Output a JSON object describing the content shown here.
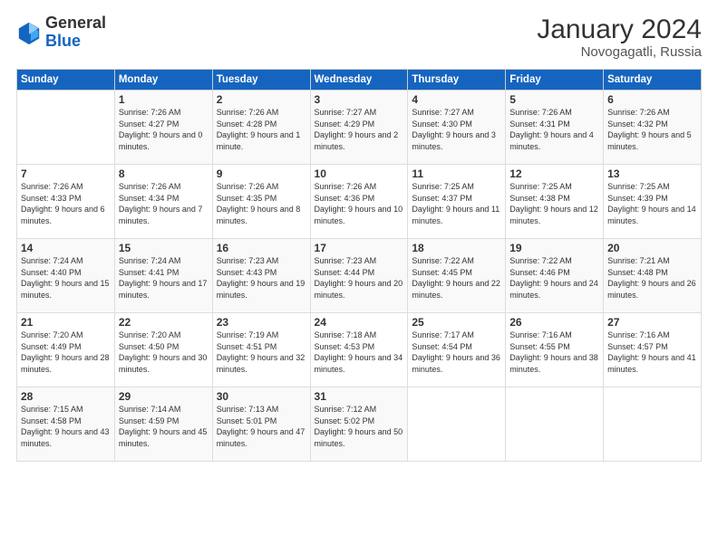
{
  "header": {
    "logo_general": "General",
    "logo_blue": "Blue",
    "month_year": "January 2024",
    "location": "Novogagatli, Russia"
  },
  "columns": [
    "Sunday",
    "Monday",
    "Tuesday",
    "Wednesday",
    "Thursday",
    "Friday",
    "Saturday"
  ],
  "weeks": [
    [
      {
        "day": "",
        "sunrise": "",
        "sunset": "",
        "daylight": ""
      },
      {
        "day": "1",
        "sunrise": "Sunrise: 7:26 AM",
        "sunset": "Sunset: 4:27 PM",
        "daylight": "Daylight: 9 hours and 0 minutes."
      },
      {
        "day": "2",
        "sunrise": "Sunrise: 7:26 AM",
        "sunset": "Sunset: 4:28 PM",
        "daylight": "Daylight: 9 hours and 1 minute."
      },
      {
        "day": "3",
        "sunrise": "Sunrise: 7:27 AM",
        "sunset": "Sunset: 4:29 PM",
        "daylight": "Daylight: 9 hours and 2 minutes."
      },
      {
        "day": "4",
        "sunrise": "Sunrise: 7:27 AM",
        "sunset": "Sunset: 4:30 PM",
        "daylight": "Daylight: 9 hours and 3 minutes."
      },
      {
        "day": "5",
        "sunrise": "Sunrise: 7:26 AM",
        "sunset": "Sunset: 4:31 PM",
        "daylight": "Daylight: 9 hours and 4 minutes."
      },
      {
        "day": "6",
        "sunrise": "Sunrise: 7:26 AM",
        "sunset": "Sunset: 4:32 PM",
        "daylight": "Daylight: 9 hours and 5 minutes."
      }
    ],
    [
      {
        "day": "7",
        "sunrise": "Sunrise: 7:26 AM",
        "sunset": "Sunset: 4:33 PM",
        "daylight": "Daylight: 9 hours and 6 minutes."
      },
      {
        "day": "8",
        "sunrise": "Sunrise: 7:26 AM",
        "sunset": "Sunset: 4:34 PM",
        "daylight": "Daylight: 9 hours and 7 minutes."
      },
      {
        "day": "9",
        "sunrise": "Sunrise: 7:26 AM",
        "sunset": "Sunset: 4:35 PM",
        "daylight": "Daylight: 9 hours and 8 minutes."
      },
      {
        "day": "10",
        "sunrise": "Sunrise: 7:26 AM",
        "sunset": "Sunset: 4:36 PM",
        "daylight": "Daylight: 9 hours and 10 minutes."
      },
      {
        "day": "11",
        "sunrise": "Sunrise: 7:25 AM",
        "sunset": "Sunset: 4:37 PM",
        "daylight": "Daylight: 9 hours and 11 minutes."
      },
      {
        "day": "12",
        "sunrise": "Sunrise: 7:25 AM",
        "sunset": "Sunset: 4:38 PM",
        "daylight": "Daylight: 9 hours and 12 minutes."
      },
      {
        "day": "13",
        "sunrise": "Sunrise: 7:25 AM",
        "sunset": "Sunset: 4:39 PM",
        "daylight": "Daylight: 9 hours and 14 minutes."
      }
    ],
    [
      {
        "day": "14",
        "sunrise": "Sunrise: 7:24 AM",
        "sunset": "Sunset: 4:40 PM",
        "daylight": "Daylight: 9 hours and 15 minutes."
      },
      {
        "day": "15",
        "sunrise": "Sunrise: 7:24 AM",
        "sunset": "Sunset: 4:41 PM",
        "daylight": "Daylight: 9 hours and 17 minutes."
      },
      {
        "day": "16",
        "sunrise": "Sunrise: 7:23 AM",
        "sunset": "Sunset: 4:43 PM",
        "daylight": "Daylight: 9 hours and 19 minutes."
      },
      {
        "day": "17",
        "sunrise": "Sunrise: 7:23 AM",
        "sunset": "Sunset: 4:44 PM",
        "daylight": "Daylight: 9 hours and 20 minutes."
      },
      {
        "day": "18",
        "sunrise": "Sunrise: 7:22 AM",
        "sunset": "Sunset: 4:45 PM",
        "daylight": "Daylight: 9 hours and 22 minutes."
      },
      {
        "day": "19",
        "sunrise": "Sunrise: 7:22 AM",
        "sunset": "Sunset: 4:46 PM",
        "daylight": "Daylight: 9 hours and 24 minutes."
      },
      {
        "day": "20",
        "sunrise": "Sunrise: 7:21 AM",
        "sunset": "Sunset: 4:48 PM",
        "daylight": "Daylight: 9 hours and 26 minutes."
      }
    ],
    [
      {
        "day": "21",
        "sunrise": "Sunrise: 7:20 AM",
        "sunset": "Sunset: 4:49 PM",
        "daylight": "Daylight: 9 hours and 28 minutes."
      },
      {
        "day": "22",
        "sunrise": "Sunrise: 7:20 AM",
        "sunset": "Sunset: 4:50 PM",
        "daylight": "Daylight: 9 hours and 30 minutes."
      },
      {
        "day": "23",
        "sunrise": "Sunrise: 7:19 AM",
        "sunset": "Sunset: 4:51 PM",
        "daylight": "Daylight: 9 hours and 32 minutes."
      },
      {
        "day": "24",
        "sunrise": "Sunrise: 7:18 AM",
        "sunset": "Sunset: 4:53 PM",
        "daylight": "Daylight: 9 hours and 34 minutes."
      },
      {
        "day": "25",
        "sunrise": "Sunrise: 7:17 AM",
        "sunset": "Sunset: 4:54 PM",
        "daylight": "Daylight: 9 hours and 36 minutes."
      },
      {
        "day": "26",
        "sunrise": "Sunrise: 7:16 AM",
        "sunset": "Sunset: 4:55 PM",
        "daylight": "Daylight: 9 hours and 38 minutes."
      },
      {
        "day": "27",
        "sunrise": "Sunrise: 7:16 AM",
        "sunset": "Sunset: 4:57 PM",
        "daylight": "Daylight: 9 hours and 41 minutes."
      }
    ],
    [
      {
        "day": "28",
        "sunrise": "Sunrise: 7:15 AM",
        "sunset": "Sunset: 4:58 PM",
        "daylight": "Daylight: 9 hours and 43 minutes."
      },
      {
        "day": "29",
        "sunrise": "Sunrise: 7:14 AM",
        "sunset": "Sunset: 4:59 PM",
        "daylight": "Daylight: 9 hours and 45 minutes."
      },
      {
        "day": "30",
        "sunrise": "Sunrise: 7:13 AM",
        "sunset": "Sunset: 5:01 PM",
        "daylight": "Daylight: 9 hours and 47 minutes."
      },
      {
        "day": "31",
        "sunrise": "Sunrise: 7:12 AM",
        "sunset": "Sunset: 5:02 PM",
        "daylight": "Daylight: 9 hours and 50 minutes."
      },
      {
        "day": "",
        "sunrise": "",
        "sunset": "",
        "daylight": ""
      },
      {
        "day": "",
        "sunrise": "",
        "sunset": "",
        "daylight": ""
      },
      {
        "day": "",
        "sunrise": "",
        "sunset": "",
        "daylight": ""
      }
    ]
  ]
}
